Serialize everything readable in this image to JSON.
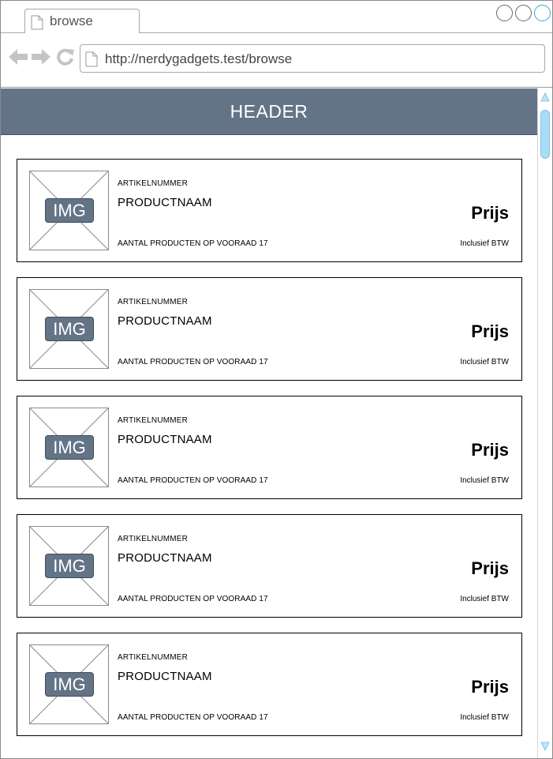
{
  "browser": {
    "tab_title": "browse",
    "url": "http://nerdygadgets.test/browse",
    "icons": {
      "back": "back-arrow-icon",
      "forward": "forward-arrow-icon",
      "reload": "reload-icon",
      "page": "document-icon"
    }
  },
  "page": {
    "header": "HEADER"
  },
  "products": [
    {
      "image_label": "IMG",
      "article_number": "ARTIKELNUMMER",
      "name": "PRODUCTNAAM",
      "stock": "AANTAL PRODUCTEN OP VOORAAD 17",
      "price": "Prijs",
      "vat": "Inclusief BTW"
    },
    {
      "image_label": "IMG",
      "article_number": "ARTIKELNUMMER",
      "name": "PRODUCTNAAM",
      "stock": "AANTAL PRODUCTEN OP VOORAAD 17",
      "price": "Prijs",
      "vat": "Inclusief BTW"
    },
    {
      "image_label": "IMG",
      "article_number": "ARTIKELNUMMER",
      "name": "PRODUCTNAAM",
      "stock": "AANTAL PRODUCTEN OP VOORAAD 17",
      "price": "Prijs",
      "vat": "Inclusief BTW"
    },
    {
      "image_label": "IMG",
      "article_number": "ARTIKELNUMMER",
      "name": "PRODUCTNAAM",
      "stock": "AANTAL PRODUCTEN OP VOORAAD 17",
      "price": "Prijs",
      "vat": "Inclusief BTW"
    },
    {
      "image_label": "IMG",
      "article_number": "ARTIKELNUMMER",
      "name": "PRODUCTNAAM",
      "stock": "AANTAL PRODUCTEN OP VOORAAD 17",
      "price": "Prijs",
      "vat": "Inclusief BTW"
    }
  ],
  "colors": {
    "header_bg": "#647487",
    "scroll_accent": "#a9dcf5"
  }
}
